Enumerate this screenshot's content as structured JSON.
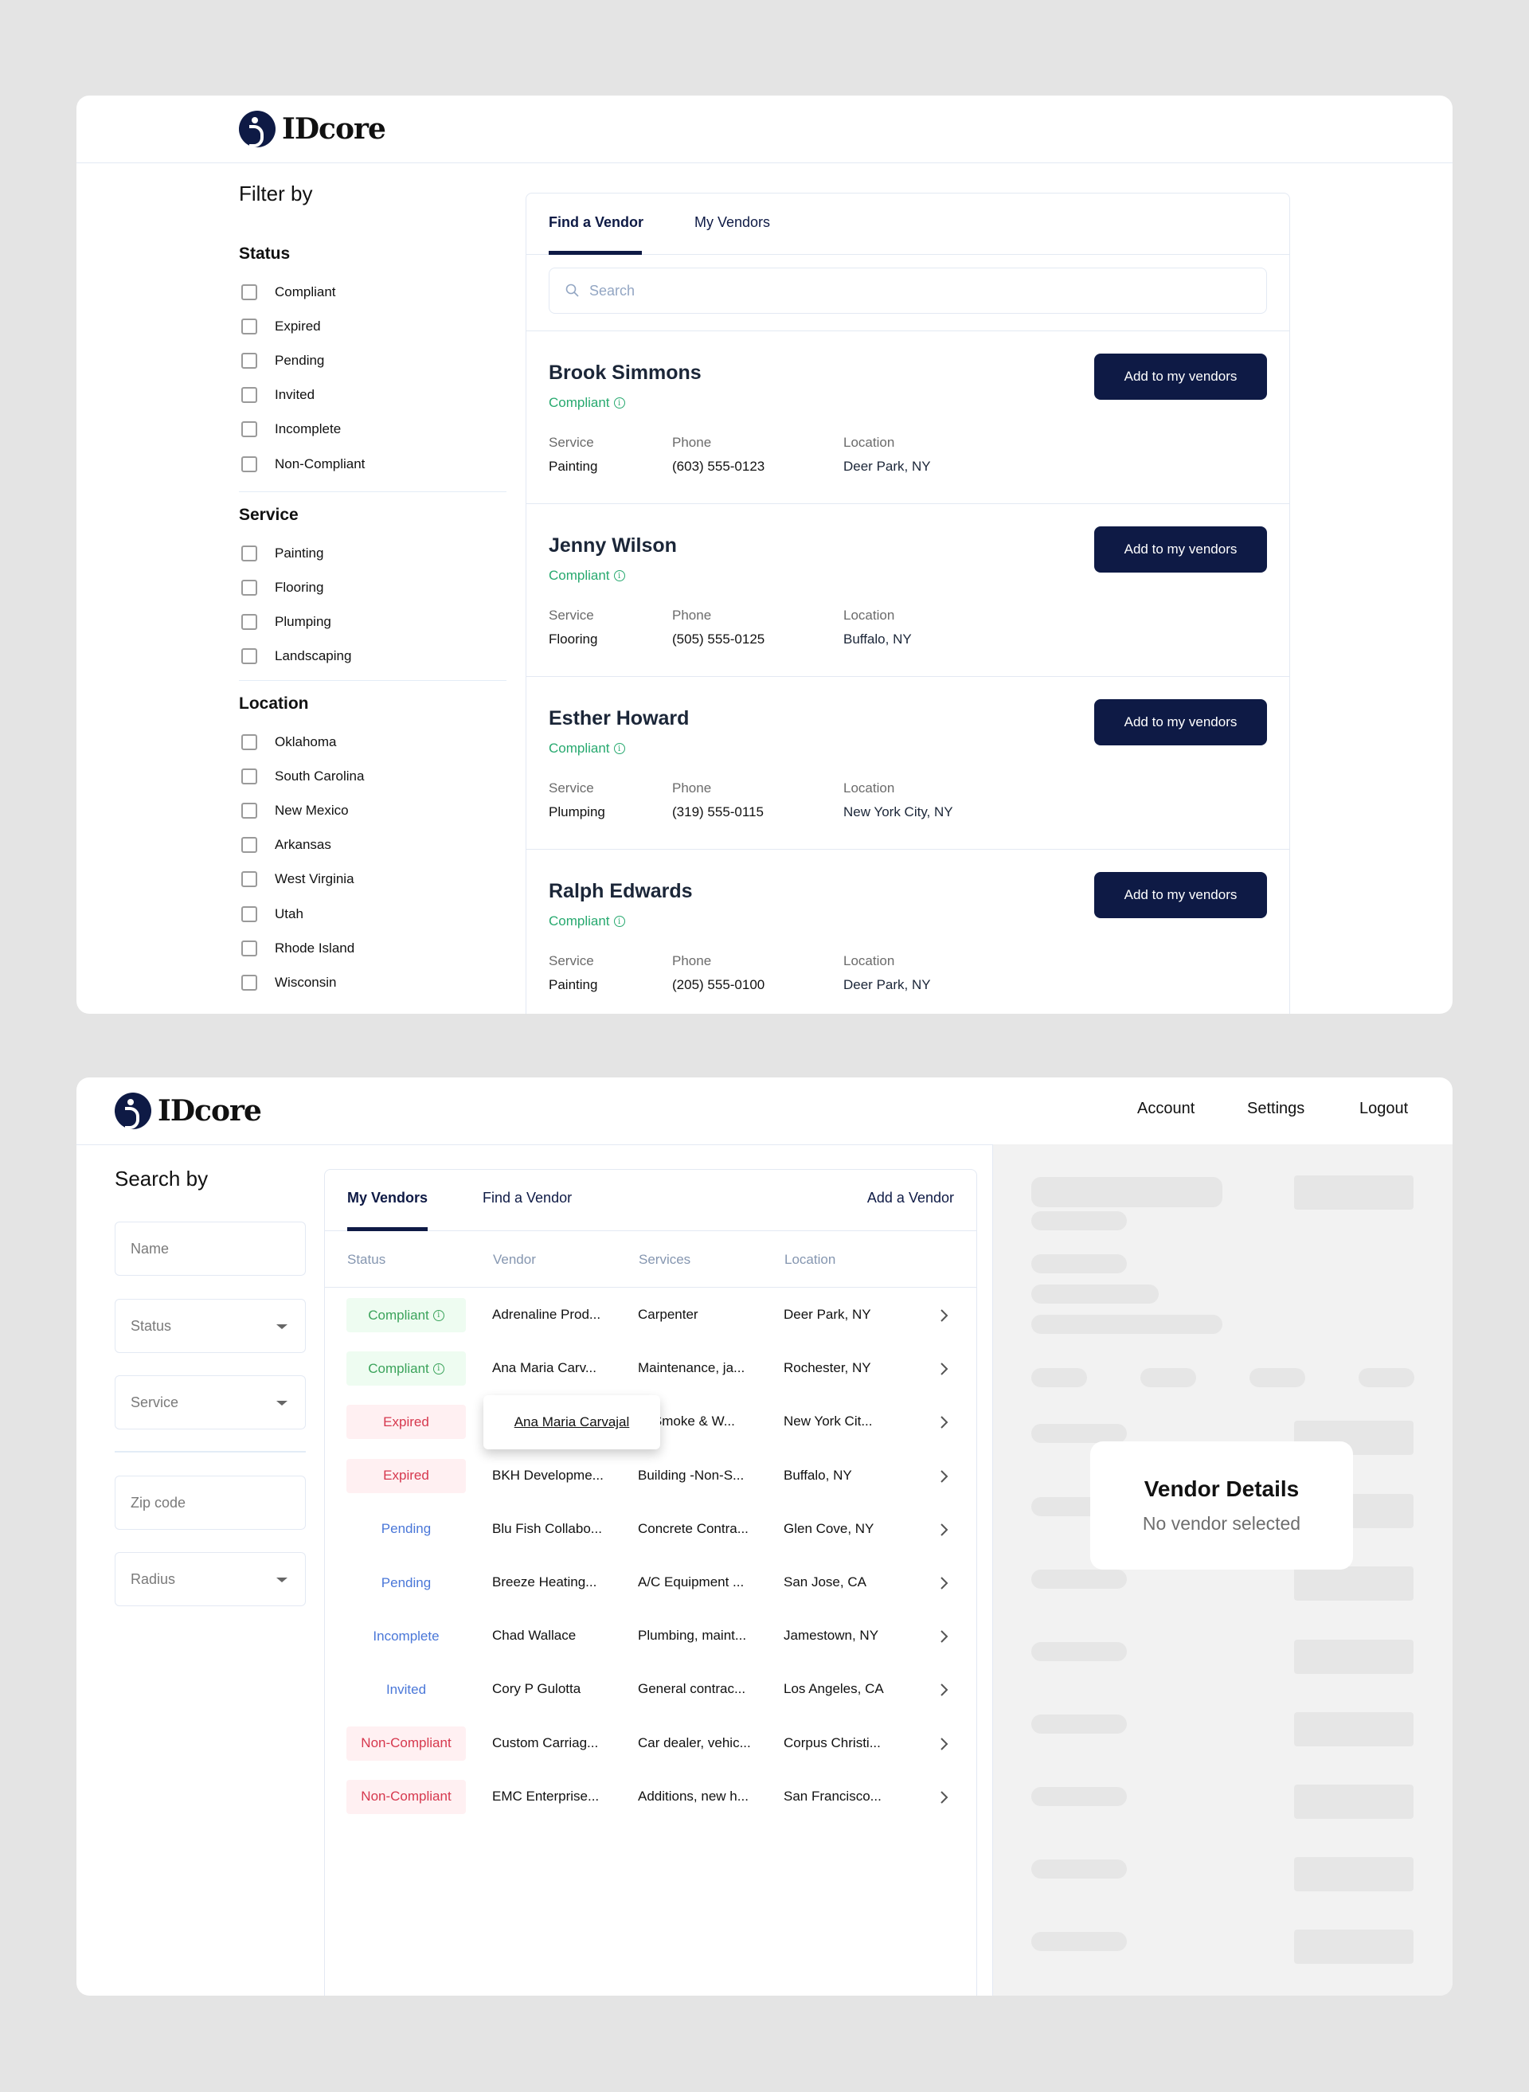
{
  "brand": {
    "name": "IDcore",
    "accent": "#0e1a45"
  },
  "find_view": {
    "filter_title": "Filter by",
    "sections": [
      {
        "title": "Status",
        "options": [
          "Compliant",
          "Expired",
          "Pending",
          "Invited",
          "Incomplete",
          "Non-Compliant"
        ]
      },
      {
        "title": "Service",
        "options": [
          "Painting",
          "Flooring",
          "Plumping",
          "Landscaping"
        ]
      },
      {
        "title": "Location",
        "options": [
          "Oklahoma",
          "South Carolina",
          "New Mexico",
          "Arkansas",
          "West Virginia",
          "Utah",
          "Rhode Island",
          "Wisconsin"
        ]
      }
    ],
    "tabs": [
      {
        "label": "Find a Vendor",
        "active": true
      },
      {
        "label": "My Vendors",
        "active": false
      }
    ],
    "search_placeholder": "Search",
    "field_labels": {
      "service": "Service",
      "phone": "Phone",
      "location": "Location"
    },
    "add_button_label": "Add to my vendors",
    "vendors": [
      {
        "name": "Brook Simmons",
        "status": "Compliant",
        "service": "Painting",
        "phone": "(603) 555-0123",
        "location": "Deer Park, NY"
      },
      {
        "name": "Jenny Wilson",
        "status": "Compliant",
        "service": "Flooring",
        "phone": "(505) 555-0125",
        "location": "Buffalo, NY"
      },
      {
        "name": "Esther Howard",
        "status": "Compliant",
        "service": "Plumping",
        "phone": "(319) 555-0115",
        "location": "New York City, NY"
      },
      {
        "name": "Ralph Edwards",
        "status": "Compliant",
        "service": "Painting",
        "phone": "(205) 555-0100",
        "location": "Deer Park, NY"
      }
    ]
  },
  "my_view": {
    "nav": [
      "Account",
      "Settings",
      "Logout"
    ],
    "search_title": "Search by",
    "fields": [
      {
        "placeholder": "Name",
        "dropdown": false
      },
      {
        "placeholder": "Status",
        "dropdown": true
      },
      {
        "placeholder": "Service",
        "dropdown": true
      },
      {
        "placeholder": "Zip code",
        "dropdown": false
      },
      {
        "placeholder": "Radius",
        "dropdown": true
      }
    ],
    "tabs": [
      {
        "label": "My Vendors",
        "active": true
      },
      {
        "label": "Find a Vendor",
        "active": false
      }
    ],
    "add_vendor_label": "Add a Vendor",
    "columns": [
      "Status",
      "Vendor",
      "Services",
      "Location"
    ],
    "rows": [
      {
        "status": "Compliant",
        "kind": "compliant",
        "vendor": "Adrenaline Prod...",
        "services": "Carpenter",
        "location": "Deer Park, NY"
      },
      {
        "status": "Compliant",
        "kind": "compliant",
        "vendor": "Ana Maria Carv...",
        "services": "Maintenance, ja...",
        "location": "Rochester, NY"
      },
      {
        "status": "Expired",
        "kind": "expired",
        "vendor": "",
        "services": "e, Smoke & W...",
        "location": "New York Cit..."
      },
      {
        "status": "Expired",
        "kind": "expired",
        "vendor": "BKH Developme...",
        "services": "Building -Non-S...",
        "location": "Buffalo, NY"
      },
      {
        "status": "Pending",
        "kind": "pending",
        "vendor": "Blu Fish Collabo...",
        "services": "Concrete Contra...",
        "location": "Glen Cove, NY"
      },
      {
        "status": "Pending",
        "kind": "pending",
        "vendor": "Breeze Heating...",
        "services": "A/C Equipment ...",
        "location": "San Jose, CA"
      },
      {
        "status": "Incomplete",
        "kind": "incomplete",
        "vendor": "Chad Wallace",
        "services": "Plumbing, maint...",
        "location": "Jamestown, NY"
      },
      {
        "status": "Invited",
        "kind": "invited",
        "vendor": "Cory P Gulotta",
        "services": "General contrac...",
        "location": "Los Angeles, CA"
      },
      {
        "status": "Non-Compliant",
        "kind": "noncompliant",
        "vendor": "Custom Carriag...",
        "services": "Car dealer, vehic...",
        "location": "Corpus Christi..."
      },
      {
        "status": "Non-Compliant",
        "kind": "noncompliant",
        "vendor": "EMC Enterprise...",
        "services": "Additions, new h...",
        "location": "San Francisco..."
      }
    ],
    "tooltip": "Ana Maria Carvajal",
    "details": {
      "title": "Vendor Details",
      "subtitle": "No vendor selected"
    }
  },
  "status_colors": {
    "compliant": "#3ba35b",
    "expired": "#d6384e",
    "pending": "#4a77d8",
    "noncompliant": "#d6384e"
  }
}
